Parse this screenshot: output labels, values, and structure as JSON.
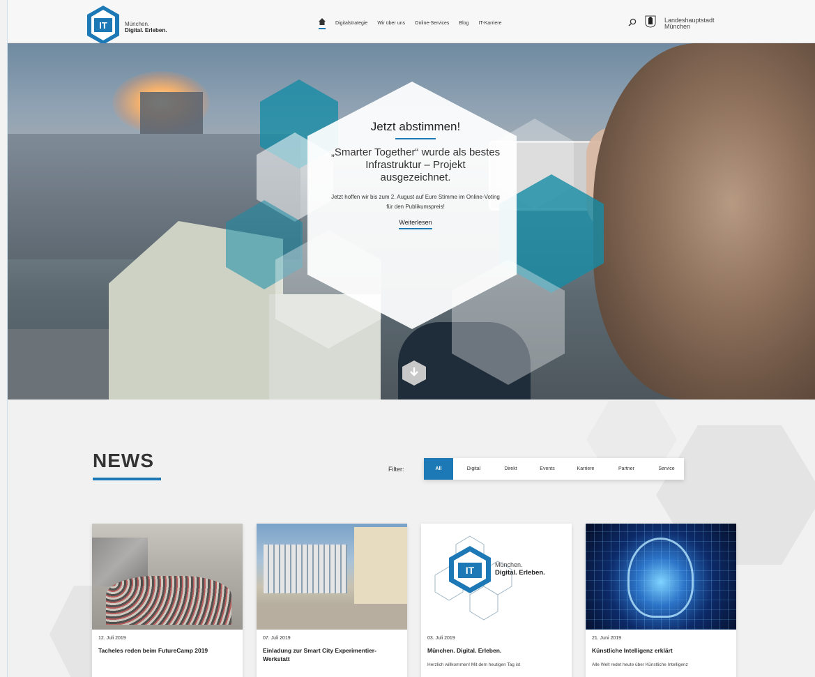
{
  "header": {
    "logo_mark": "IT",
    "logo_line1": "München.",
    "logo_line2": "Digital. Erleben.",
    "nav": [
      "Digitalstrategie",
      "Wir über uns",
      "Online-Services",
      "Blog",
      "IT-Karriere"
    ],
    "city_line1": "Landeshauptstadt",
    "city_line2": "München"
  },
  "hero": {
    "title": "Jetzt abstimmen!",
    "subtitle": "„Smarter Together“ wurde als bestes Infrastruktur – Projekt ausgezeichnet.",
    "body": "Jetzt hoffen wir bis zum 2. August auf Eure Stimme im Online-Voting für den Publikumspreis!",
    "link": "Weiterlesen"
  },
  "news": {
    "title": "NEWS",
    "filter_label": "Filter:",
    "filters": [
      "All",
      "Digital",
      "Direkt",
      "Events",
      "Karriere",
      "Partner",
      "Service"
    ],
    "cards": [
      {
        "date": "12. Juli 2019",
        "title": "Tacheles reden beim FutureCamp 2019",
        "text": ""
      },
      {
        "date": "07. Juli 2019",
        "title": "Einladung zur Smart City Experimentier-Werkstatt",
        "text": ""
      },
      {
        "date": "03. Juli 2019",
        "title": "München. Digital. Erleben.",
        "text": "Herzlich willkommen! Mit dem heutigen Tag ist"
      },
      {
        "date": "21. Juni 2019",
        "title": "Künstliche Intelligenz erklärt",
        "text": "Alle Welt redet heute über Künstliche Intelligenz"
      }
    ]
  },
  "colors": {
    "accent": "#1d79b5",
    "teal": "#178ca5"
  }
}
